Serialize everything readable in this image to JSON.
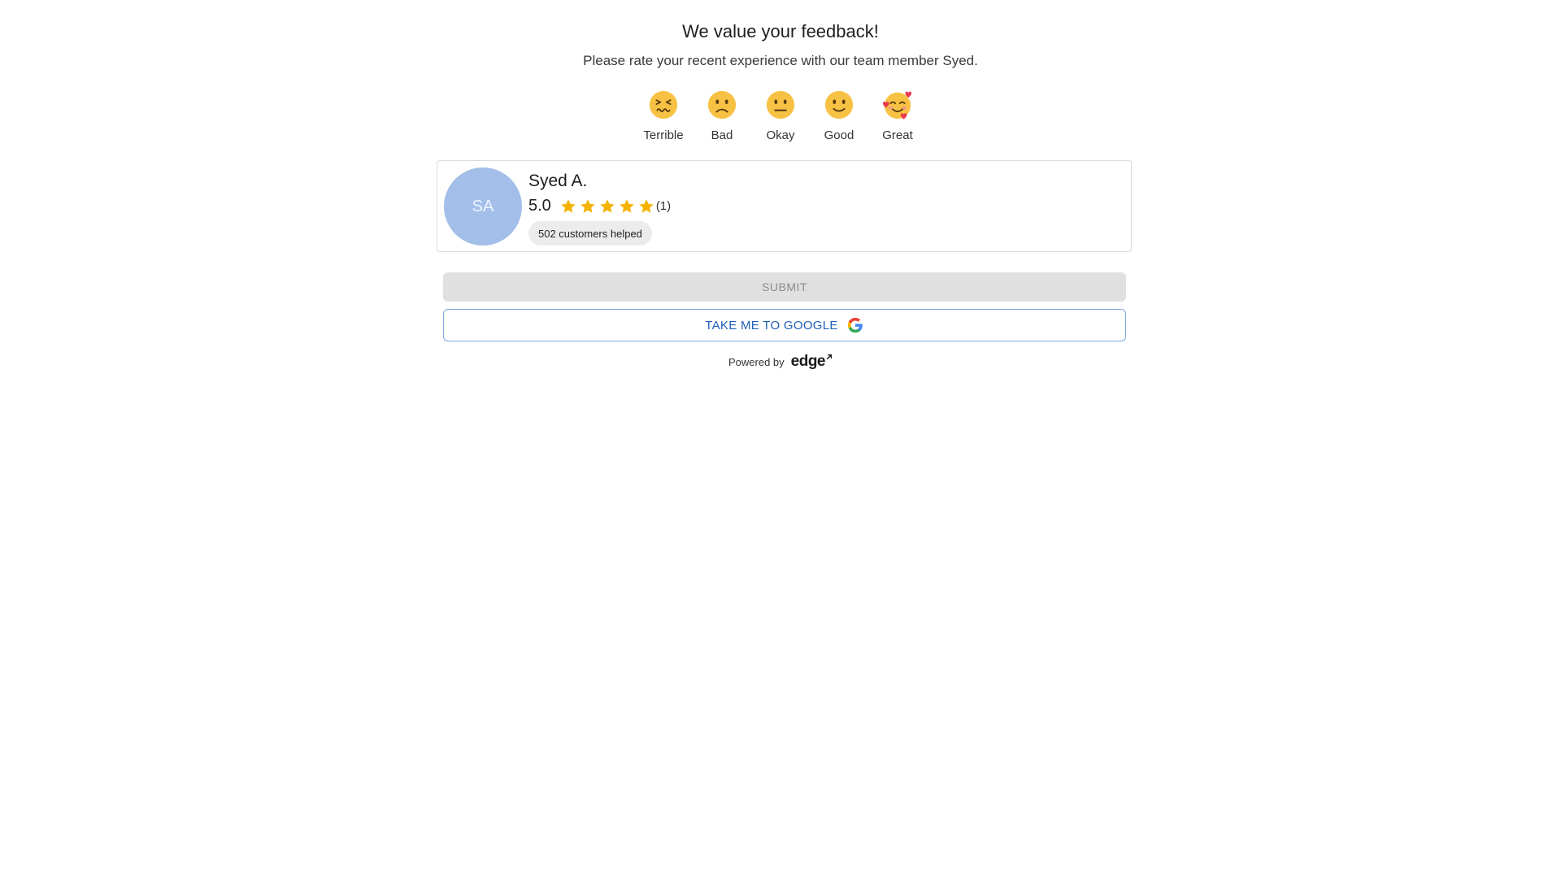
{
  "header": {
    "title": "We value your feedback!",
    "subtitle": "Please rate your recent experience with our team member Syed."
  },
  "ratings": [
    {
      "label": "Terrible",
      "icon": "grimacing-face-icon"
    },
    {
      "label": "Bad",
      "icon": "slightly-frowning-face-icon"
    },
    {
      "label": "Okay",
      "icon": "neutral-face-icon"
    },
    {
      "label": "Good",
      "icon": "slightly-smiling-face-icon"
    },
    {
      "label": "Great",
      "icon": "smiling-face-with-hearts-icon"
    }
  ],
  "member": {
    "initials": "SA",
    "name": "Syed A.",
    "score": "5.0",
    "stars": 5,
    "review_count": "(1)",
    "helped": "502 customers helped"
  },
  "actions": {
    "submit_label": "SUBMIT",
    "google_label": "TAKE ME TO GOOGLE"
  },
  "footer": {
    "powered_by": "Powered by",
    "brand": "edge"
  },
  "colors": {
    "avatar": "#a3bfe9",
    "star": "#f5b301",
    "google_text": "#1f5fb8",
    "submit_bg": "#e0e0e0"
  }
}
